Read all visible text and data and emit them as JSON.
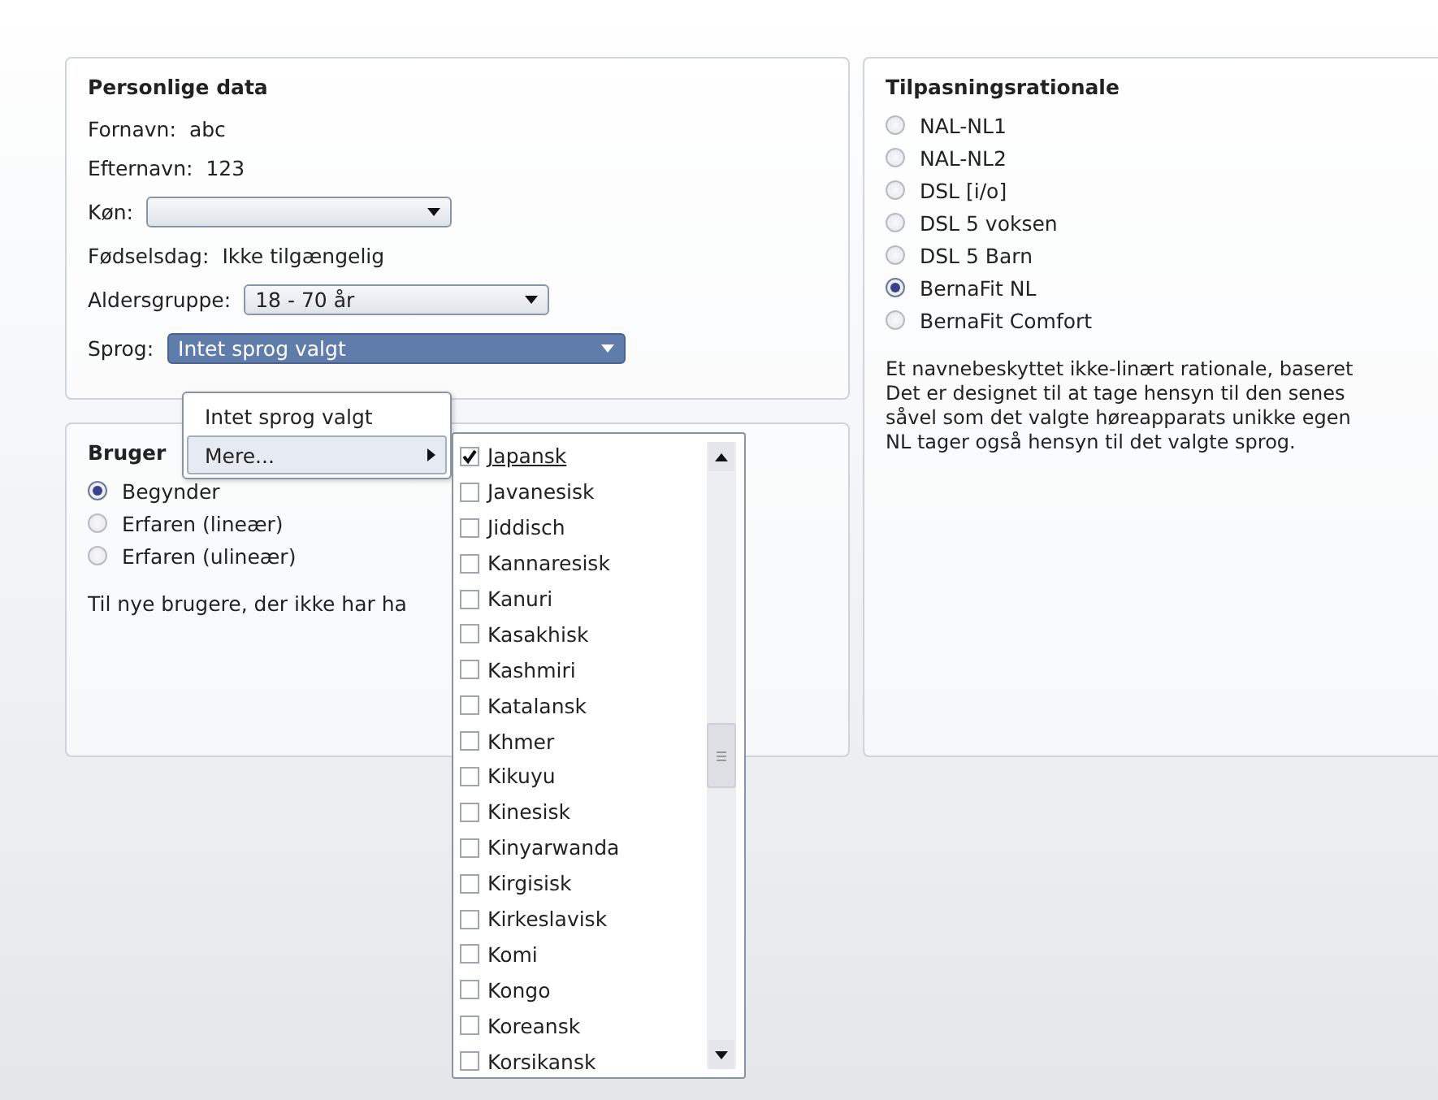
{
  "personal": {
    "title": "Personlige data",
    "fields": [
      {
        "kind": "text",
        "label": "Fornavn:",
        "value": "abc"
      },
      {
        "kind": "text",
        "label": "Efternavn:",
        "value": "123"
      },
      {
        "kind": "combo",
        "label": "Køn:",
        "focused": false
      },
      {
        "kind": "text",
        "label": "Fødselsdag:",
        "value": "Ikke tilgængelig"
      },
      {
        "kind": "combo",
        "label": "Aldersgruppe:",
        "value": "18 - 70 år",
        "focused": false
      },
      {
        "kind": "combo",
        "label": "Sprog:",
        "value": "Intet sprog valgt",
        "focused": true
      }
    ]
  },
  "user": {
    "title": "Bruger",
    "options": [
      {
        "label": "Begynder",
        "selected": true
      },
      {
        "label": "Erfaren (lineær)",
        "selected": false
      },
      {
        "label": "Erfaren (ulineær)",
        "selected": false
      }
    ],
    "description": "Til nye brugere, der ikke har ha"
  },
  "rationale": {
    "title": "Tilpasningsrationale",
    "options": [
      {
        "label": "NAL-NL1",
        "selected": false
      },
      {
        "label": "NAL-NL2",
        "selected": false
      },
      {
        "label": "DSL [i/o]",
        "selected": false
      },
      {
        "label": "DSL 5 voksen",
        "selected": false
      },
      {
        "label": "DSL 5 Barn",
        "selected": false
      },
      {
        "label": "BernaFit NL",
        "selected": true
      },
      {
        "label": "BernaFit Comfort",
        "selected": false
      }
    ],
    "description": [
      "Et navnebeskyttet ikke-linært rationale, baseret",
      "Det er designet til at tage hensyn til den senes",
      "såvel som det valgte høreapparats unikke egen",
      "NL tager også hensyn til det valgte sprog."
    ]
  },
  "menu": {
    "items": [
      {
        "label": "Intet sprog valgt",
        "submenu": false,
        "selected": false
      },
      {
        "label": "Mere...",
        "submenu": true,
        "selected": true
      }
    ]
  },
  "languages": [
    {
      "label": "Japansk",
      "checked": true
    },
    {
      "label": "Javanesisk",
      "checked": false
    },
    {
      "label": "Jiddisch",
      "checked": false
    },
    {
      "label": "Kannaresisk",
      "checked": false
    },
    {
      "label": "Kanuri",
      "checked": false
    },
    {
      "label": "Kasakhisk",
      "checked": false
    },
    {
      "label": "Kashmiri",
      "checked": false
    },
    {
      "label": "Katalansk",
      "checked": false
    },
    {
      "label": "Khmer",
      "checked": false
    },
    {
      "label": "Kikuyu",
      "checked": false
    },
    {
      "label": "Kinesisk",
      "checked": false
    },
    {
      "label": "Kinyarwanda",
      "checked": false
    },
    {
      "label": "Kirgisisk",
      "checked": false
    },
    {
      "label": "Kirkeslavisk",
      "checked": false
    },
    {
      "label": "Komi",
      "checked": false
    },
    {
      "label": "Kongo",
      "checked": false
    },
    {
      "label": "Koreansk",
      "checked": false
    },
    {
      "label": "Korsikansk",
      "checked": false
    }
  ]
}
